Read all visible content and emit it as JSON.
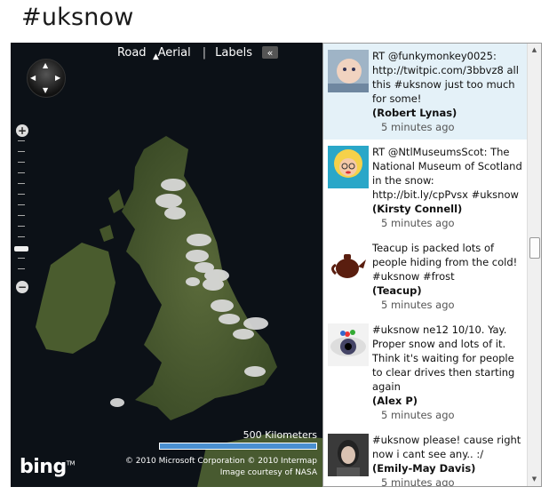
{
  "page": {
    "title": "#uksnow"
  },
  "map": {
    "nav": {
      "road": "Road",
      "aerial": "Aerial",
      "labels": "Labels",
      "collapse": "«"
    },
    "zoom": {
      "in": "+",
      "out": "−"
    },
    "scale_label": "500 Kilometers",
    "brand": "bing",
    "copyright": "© 2010 Microsoft Corporation   © 2010 Intermap",
    "imagery": "Image courtesy of NASA"
  },
  "feed": {
    "tweets": [
      {
        "text": "RT @funkymonkey0025: http://twitpic.com/3bbvz8 all this #uksnow just too much for some!",
        "author": "(Robert Lynas)",
        "time": "5 minutes ago",
        "avatar_icon": "baby-photo"
      },
      {
        "text": "RT @NtlMuseumsScot: The National Museum of Scotland in the snow: http://bit.ly/cpPvsx #uksnow",
        "author": "(Kirsty Connell)",
        "time": "5 minutes ago",
        "avatar_icon": "cartoon-woman"
      },
      {
        "text": "Teacup is packed lots of people hiding from the cold! #uksnow #frost",
        "author": "(Teacup)",
        "time": "5 minutes ago",
        "avatar_icon": "teapot"
      },
      {
        "text": "#uksnow ne12 10/10. Yay. Proper snow and lots of it. Think it's waiting for people to clear drives then starting again",
        "author": "(Alex P)",
        "time": "5 minutes ago",
        "avatar_icon": "eye"
      },
      {
        "text": "#uksnow please! cause right now i cant see any.. :/",
        "author": "(Emily-May Davis)",
        "time": "5 minutes ago",
        "avatar_icon": "portrait"
      }
    ]
  }
}
